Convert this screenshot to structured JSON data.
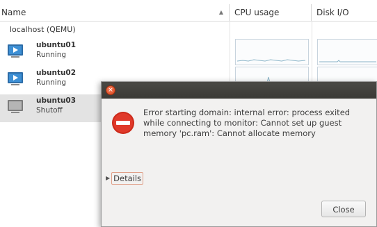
{
  "columns": {
    "name": "Name",
    "cpu": "CPU usage",
    "disk": "Disk I/O"
  },
  "group_label": "localhost (QEMU)",
  "vms": [
    {
      "name": "ubuntu01",
      "status": "Running",
      "icon": "vm-running-icon"
    },
    {
      "name": "ubuntu02",
      "status": "Running",
      "icon": "vm-running-icon"
    },
    {
      "name": "ubuntu03",
      "status": "Shutoff",
      "icon": "vm-shutoff-icon"
    }
  ],
  "dialog": {
    "message": "Error starting domain: internal error: process exited while connecting to monitor: Cannot set up guest memory 'pc.ram': Cannot allocate memory",
    "details_label": "Details",
    "close_label": "Close",
    "icon": "error-icon"
  },
  "colors": {
    "graph_line": "#8ab4c8",
    "error_red": "#cc2a1a",
    "titlebar": "#3b3a36"
  }
}
